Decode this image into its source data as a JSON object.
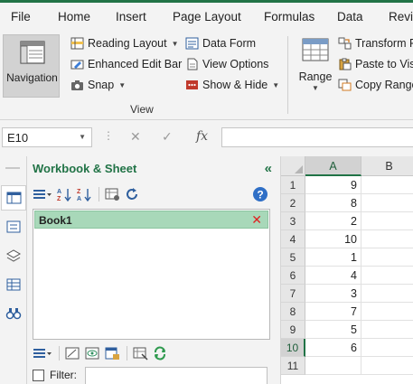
{
  "menu": {
    "tabs": [
      "File",
      "Home",
      "Insert",
      "Page Layout",
      "Formulas",
      "Data",
      "Revie"
    ]
  },
  "ribbon": {
    "navigation_label": "Navigation",
    "reading_layout": "Reading Layout",
    "enhanced_edit_bar": "Enhanced Edit Bar",
    "snap": "Snap",
    "data_form": "Data Form",
    "view_options": "View Options",
    "show_hide": "Show & Hide",
    "group_view": "View",
    "range": "Range",
    "transform_range": "Transform Ra",
    "paste_to_visible": "Paste to Visil",
    "copy_ranges": "Copy Range",
    "accent_color": "#217346"
  },
  "formula_bar": {
    "name_box": "E10",
    "cancel_glyph": "✕",
    "enter_glyph": "✓",
    "fx_label": "fx",
    "formula": ""
  },
  "pane": {
    "title": "Workbook & Sheet",
    "collapse_glyph": "«",
    "workbooks": [
      {
        "name": "Book1",
        "close_glyph": "✕"
      }
    ],
    "filter_label": "Filter:",
    "filter_value": "",
    "filter_checked": false
  },
  "sheet": {
    "columns": [
      "A",
      "B"
    ],
    "selected_row": "10",
    "rows": [
      {
        "num": "1",
        "a": "9"
      },
      {
        "num": "2",
        "a": "8"
      },
      {
        "num": "3",
        "a": "2"
      },
      {
        "num": "4",
        "a": "10"
      },
      {
        "num": "5",
        "a": "1"
      },
      {
        "num": "6",
        "a": "4"
      },
      {
        "num": "7",
        "a": "3"
      },
      {
        "num": "8",
        "a": "7"
      },
      {
        "num": "9",
        "a": "5"
      },
      {
        "num": "10",
        "a": "6"
      },
      {
        "num": "11",
        "a": ""
      }
    ]
  }
}
